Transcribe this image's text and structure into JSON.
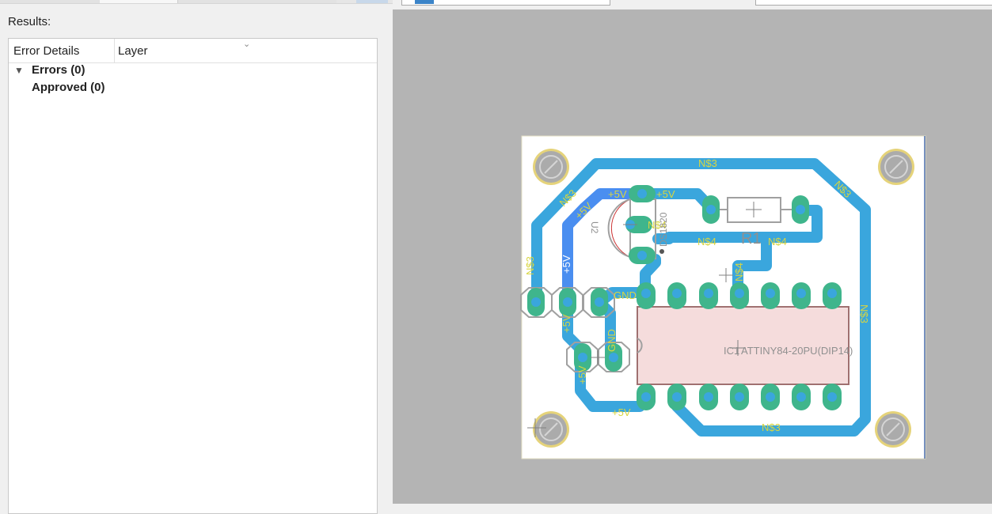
{
  "results": {
    "label": "Results:",
    "columns": [
      "Error Details",
      "Layer"
    ],
    "tree": [
      {
        "label": "Errors (0)",
        "expanded": true
      },
      {
        "label": "Approved (0)"
      }
    ]
  },
  "pcb": {
    "net_labels": {
      "n3": "N$3",
      "n4": "N$4",
      "p5v": "+5V",
      "gnd": "GND"
    },
    "component_labels": {
      "u2": "U2",
      "ds": "DS1820",
      "r1": "R1",
      "ic": "ATTINY84-20PU(DIP14)",
      "ic_prefix": "IC1"
    },
    "colors": {
      "trace": "#3aa6dd",
      "trace_highlight": "#4a8ef0",
      "pad": "#3fb58c",
      "net_label": "#d8d640",
      "board": "#ffffff",
      "background": "#b4b4b4"
    }
  }
}
